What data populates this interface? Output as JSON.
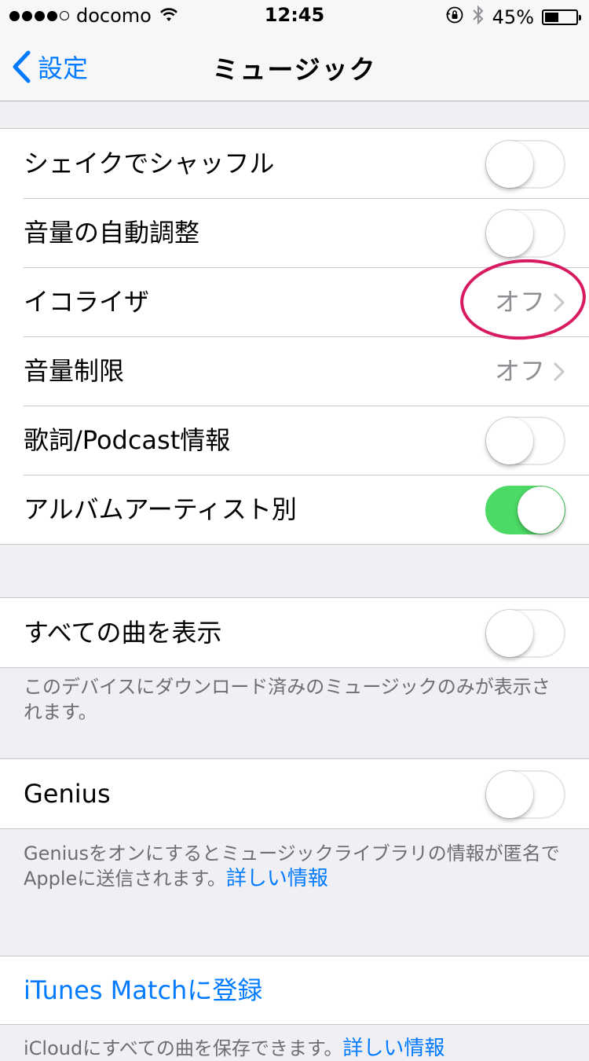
{
  "status_bar": {
    "signal_bars_filled": 4,
    "signal_bars_total": 5,
    "carrier": "docomo",
    "time": "12:45",
    "battery_percent": "45%",
    "battery_level": 0.45,
    "icons": [
      "wifi-icon",
      "rotation-lock-icon",
      "bluetooth-icon",
      "battery-icon"
    ]
  },
  "nav": {
    "back_label": "設定",
    "title": "ミュージック"
  },
  "group1": {
    "shake": {
      "label": "シェイクでシャッフル",
      "on": false
    },
    "sound_check": {
      "label": "音量の自動調整",
      "on": false
    },
    "eq": {
      "label": "イコライザ",
      "value": "オフ"
    },
    "volume_limit": {
      "label": "音量制限",
      "value": "オフ"
    },
    "lyrics": {
      "label": "歌詞/Podcast情報",
      "on": false
    },
    "album_artist": {
      "label": "アルバムアーティスト別",
      "on": true
    }
  },
  "group2": {
    "show_all": {
      "label": "すべての曲を表示",
      "on": false
    },
    "footer": "このデバイスにダウンロード済みのミュージックのみが表示されます。"
  },
  "group3": {
    "genius": {
      "label": "Genius",
      "on": false
    },
    "footer_text": "Geniusをオンにするとミュージックライブラリの情報が匿名でAppleに送信されます。",
    "footer_link": "詳しい情報"
  },
  "group4": {
    "itunes_match": "iTunes Matchに登録",
    "footer_text": "iCloudにすべての曲を保存できます。",
    "footer_link": "詳しい情報"
  },
  "colors": {
    "accent": "#007aff",
    "toggle_on": "#4cd964",
    "highlight": "#d81b60",
    "background": "#efeff4"
  }
}
